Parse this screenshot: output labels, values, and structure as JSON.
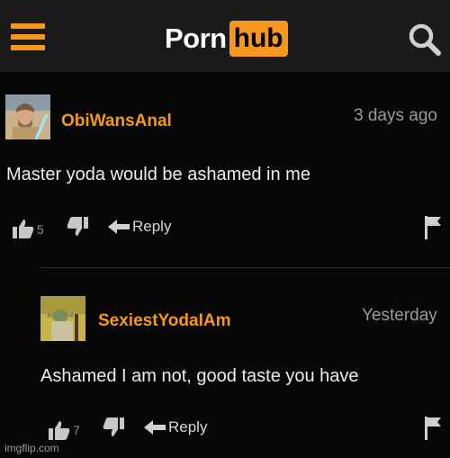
{
  "header": {
    "logo_left": "Porn",
    "logo_right": "hub",
    "accent": "#f7971d",
    "menu_icon": "hamburger-menu-icon",
    "search_icon": "search-icon"
  },
  "comments": [
    {
      "username": "ObiWansAnal",
      "time": "3 days ago",
      "text": "Master yoda would be ashamed in me",
      "likes": "5",
      "reply_label": "Reply"
    },
    {
      "username": "SexiestYodaIAm",
      "time": "Yesterday",
      "text": "Ashamed I am not, good taste you have",
      "likes": "7",
      "reply_label": "Reply"
    }
  ],
  "watermark": "imgflip.com"
}
